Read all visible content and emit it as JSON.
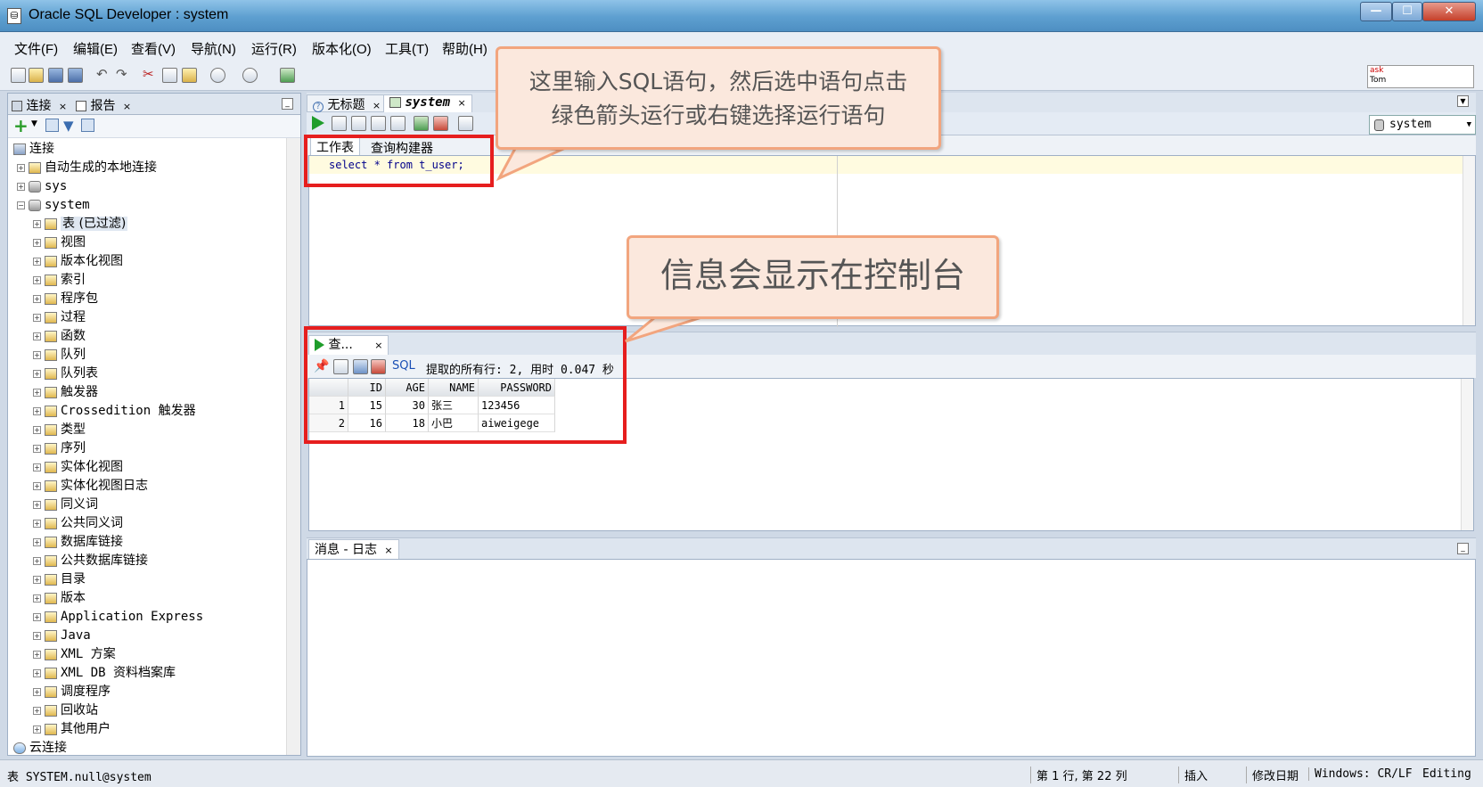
{
  "window": {
    "title": "Oracle SQL Developer : system"
  },
  "menu": [
    "文件(F)",
    "编辑(E)",
    "查看(V)",
    "导航(N)",
    "运行(R)",
    "版本化(O)",
    "工具(T)",
    "帮助(H)"
  ],
  "asktom": {
    "line1": "ask",
    "line2": "Tom"
  },
  "left_panel": {
    "tabs": [
      {
        "label": "连接",
        "close": "×"
      },
      {
        "label": "报告",
        "close": "×"
      }
    ],
    "tree": [
      {
        "label": "连接",
        "level": 0
      },
      {
        "label": "自动生成的本地连接",
        "level": 1
      },
      {
        "label": "sys",
        "level": 1
      },
      {
        "label": "system",
        "level": 1
      },
      {
        "label": "表 (已过滤)",
        "level": 2
      },
      {
        "label": "视图",
        "level": 2
      },
      {
        "label": "版本化视图",
        "level": 2
      },
      {
        "label": "索引",
        "level": 2
      },
      {
        "label": "程序包",
        "level": 2
      },
      {
        "label": "过程",
        "level": 2
      },
      {
        "label": "函数",
        "level": 2
      },
      {
        "label": "队列",
        "level": 2
      },
      {
        "label": "队列表",
        "level": 2
      },
      {
        "label": "触发器",
        "level": 2
      },
      {
        "label": "Crossedition 触发器",
        "level": 2
      },
      {
        "label": "类型",
        "level": 2
      },
      {
        "label": "序列",
        "level": 2
      },
      {
        "label": "实体化视图",
        "level": 2
      },
      {
        "label": "实体化视图日志",
        "level": 2
      },
      {
        "label": "同义词",
        "level": 2
      },
      {
        "label": "公共同义词",
        "level": 2
      },
      {
        "label": "数据库链接",
        "level": 2
      },
      {
        "label": "公共数据库链接",
        "level": 2
      },
      {
        "label": "目录",
        "level": 2
      },
      {
        "label": "版本",
        "level": 2
      },
      {
        "label": "Application Express",
        "level": 2
      },
      {
        "label": "Java",
        "level": 2
      },
      {
        "label": "XML 方案",
        "level": 2
      },
      {
        "label": "XML DB 资料档案库",
        "level": 2
      },
      {
        "label": "调度程序",
        "level": 2
      },
      {
        "label": "回收站",
        "level": 2
      },
      {
        "label": "其他用户",
        "level": 2
      },
      {
        "label": "云连接",
        "level": 0
      }
    ]
  },
  "editor": {
    "tabs": [
      {
        "label": "无标题",
        "close": "×"
      },
      {
        "label": "system",
        "close": "×"
      }
    ],
    "connection": "system",
    "worksheet_tabs": [
      "工作表",
      "查询构建器"
    ],
    "sql": "select * from  t_user;"
  },
  "results": {
    "tab_label": "查...",
    "tab_close": "×",
    "sql_link": "SQL",
    "status": "提取的所有行: 2, 用时 0.047 秒",
    "columns": [
      "ID",
      "AGE",
      "NAME",
      "PASSWORD"
    ],
    "rows": [
      {
        "n": "1",
        "ID": "15",
        "AGE": "30",
        "NAME": "张三",
        "PASSWORD": "123456"
      },
      {
        "n": "2",
        "ID": "16",
        "AGE": "18",
        "NAME": "小巴",
        "PASSWORD": "aiweigege"
      }
    ]
  },
  "messages": {
    "tab_label": "消息 - 日志",
    "close": "×"
  },
  "statusbar": {
    "left": "表 SYSTEM.null@system",
    "position": "第 1 行, 第 22 列",
    "insert": "插入",
    "modified": "修改日期",
    "lineend": "Windows: CR/LF",
    "mode": "Editing"
  },
  "annotations": {
    "callout1": "这里输入SQL语句，然后选中语句点击绿色箭头运行或右键选择运行语句",
    "callout2": "信息会显示在控制台"
  },
  "colors": {
    "annotation_red": "#e61e1e",
    "callout_border": "#f2a57e",
    "callout_fill": "#fbe8dd",
    "run_green": "#1f9d2b"
  }
}
